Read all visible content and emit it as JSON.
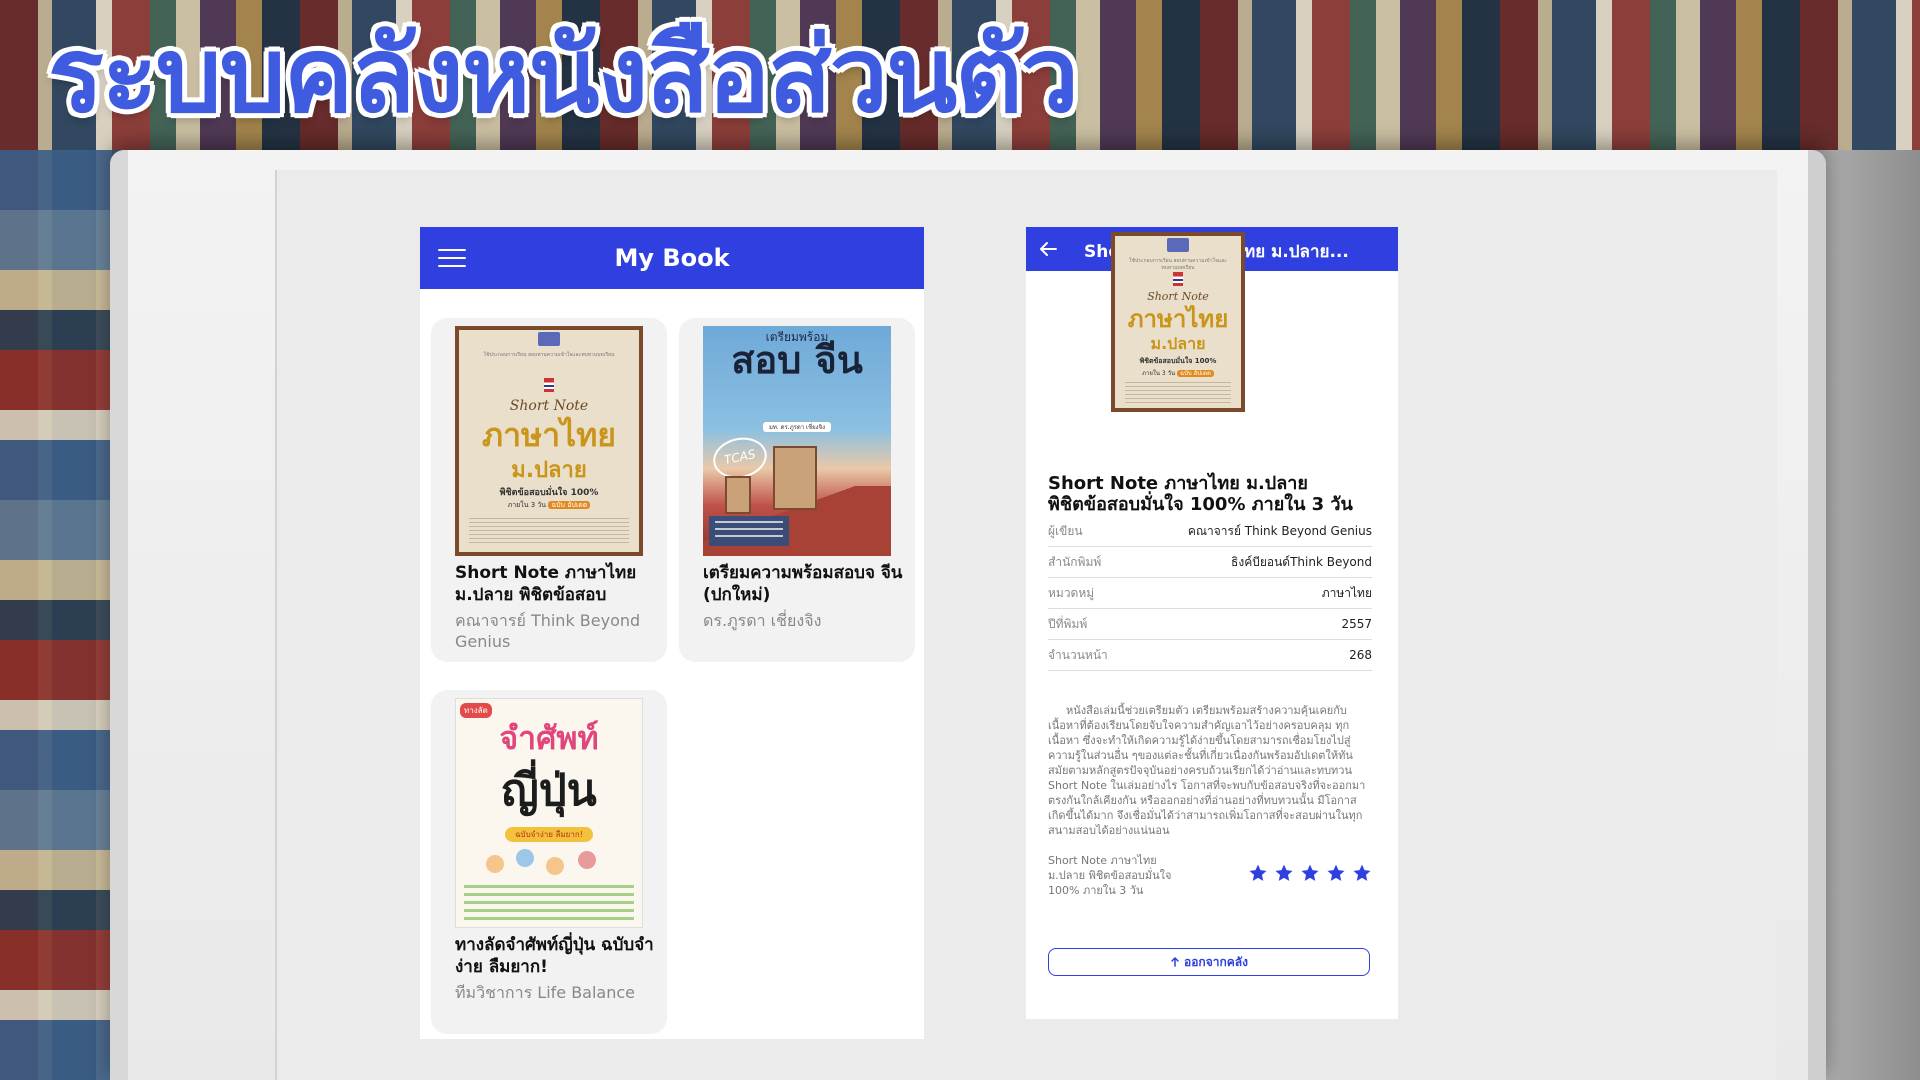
{
  "headline": "ระบบคลังหนังสือส่วนตัว",
  "colors": {
    "primary": "#2f3fe0",
    "headline": "#3f5be0",
    "card_bg": "#f2f2f2",
    "star": "#2f3fe0"
  },
  "library": {
    "app_title": "My Book",
    "menu_icon": "menu-icon",
    "books": [
      {
        "title": "Short Note ภาษาไทย ม.ปลาย พิชิตข้อสอบ",
        "author": "คณาจารย์ Think Beyond Genius",
        "cover": {
          "small": "ใช้ประกอบการเรียน สอบทานความเข้าใจและทบทวนบทเรียน",
          "script": "Short Note",
          "big": "ภาษาไทย",
          "mid": "ม.ปลาย",
          "sub": "พิชิตข้อสอบมั่นใจ 100%",
          "tag_prefix": "ภายใน 3 วัน",
          "tag": "ฉบับ อัปเดต"
        }
      },
      {
        "title": "เตรียมความพร้อมสอบจ จีน (ปกใหม่)",
        "author": "ดร.ภูรดา เชี่ยงจิง",
        "cover": {
          "top": "เตรียมพร้อม",
          "big": "สอบ จีน",
          "author_tag": "มท. ดร.ภูรดา เชี่ยงจิง",
          "badge": "TCAS"
        }
      },
      {
        "title": "ทางลัดจำศัพท์ญี่ปุ่น ฉบับจำง่าย ลืมยาก!",
        "author": "ทีมวิชาการ Life Balance",
        "cover": {
          "tag": "ทางลัด",
          "pink": "จำศัพท์",
          "black": "ญี่ปุ่น",
          "ribbon": "ฉบับจำง่าย ลืมยาก!"
        }
      }
    ]
  },
  "detail": {
    "app_title": "Short Note ภาษาไทย ม.ปลาย...",
    "back_icon": "arrow-left-icon",
    "title_line1": "Short Note ภาษาไทย ม.ปลาย",
    "title_line2": "พิชิตข้อสอบมั่นใจ 100% ภายใน 3 วัน",
    "info": [
      {
        "label": "ผู้เขียน",
        "value": "คณาจารย์ Think Beyond Genius"
      },
      {
        "label": "สำนักพิมพ์",
        "value": "ธิงค์บียอนด์Think Beyond"
      },
      {
        "label": "หมวดหมู่",
        "value": "ภาษาไทย"
      },
      {
        "label": "ปีที่พิมพ์",
        "value": "2557"
      },
      {
        "label": "จำนวนหน้า",
        "value": "268"
      }
    ],
    "description": "หนังสือเล่มนี้ช่วยเตรียมตัว เตรียมพร้อมสร้างความคุ้นเคยกับเนื้อหาที่ต้องเรียนโดยจับใจความสำคัญเอาไว้อย่างครอบคลุม ทุกเนื้อหา ซึ่งจะทำให้เกิดความรู้ได้ง่ายขึ้นโดยสามารถเชื่อมโยงไปสู่ความรู้ในส่วนอื่น ๆของแต่ละชั้นที่เกี่ยวเนื่องกันพร้อมอัปเดตให้ทันสมัยตามหลักสูตรปัจจุบันอย่างครบถ้วนเรียกได้ว่าอ่านและทบทวน Short Note ในเล่มอย่างไร โอกาสที่จะพบกับข้อสอบจริงที่จะออกมาตรงกันใกล้เคียงกัน หรือออกอย่างที่อ่านอย่างที่ทบทวนนั้น มีโอกาสเกิดขึ้นได้มาก จึงเชื่อมั่นได้ว่าสามารถเพิ่มโอกาสที่จะสอบผ่านในทุกสนามสอบได้อย่างแน่นอน",
    "rating_label": "Short Note ภาษาไทย ม.ปลาย พิชิตข้อสอบมั่นใจ 100% ภายใน 3 วัน",
    "rating": 5,
    "rating_max": 5,
    "remove_label": "ออกจากคลัง",
    "remove_icon": "arrow-up-icon"
  }
}
